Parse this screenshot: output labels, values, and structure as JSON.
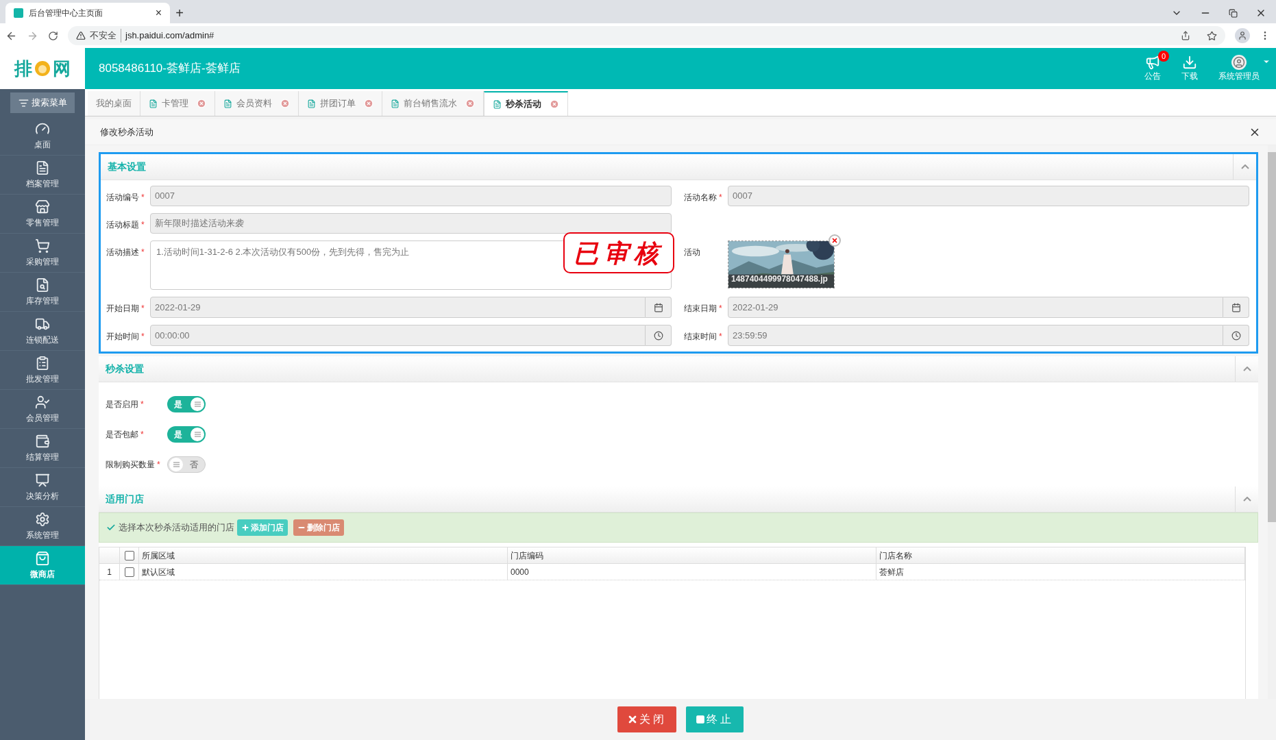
{
  "browser": {
    "tab_title": "后台管理中心主页面",
    "tab_close": "×",
    "new_tab": "+",
    "security": "不安全",
    "url": "jsh.paidui.com/admin#"
  },
  "header": {
    "logo_left": "排",
    "logo_right": "网",
    "title": "8058486110-荟鲜店-荟鲜店",
    "actions": [
      {
        "kind": "notice",
        "label": "公告",
        "badge": "0"
      },
      {
        "kind": "download",
        "label": "下载"
      },
      {
        "kind": "user",
        "label": "系统管理员"
      }
    ]
  },
  "sidebar": {
    "search": "搜索菜单",
    "items": [
      {
        "label": "桌面",
        "selected": false
      },
      {
        "label": "档案管理",
        "selected": false
      },
      {
        "label": "零售管理",
        "selected": false
      },
      {
        "label": "采购管理",
        "selected": false
      },
      {
        "label": "库存管理",
        "selected": false
      },
      {
        "label": "连锁配送",
        "selected": false
      },
      {
        "label": "批发管理",
        "selected": false
      },
      {
        "label": "会员管理",
        "selected": false
      },
      {
        "label": "结算管理",
        "selected": false
      },
      {
        "label": "决策分析",
        "selected": false
      },
      {
        "label": "系统管理",
        "selected": false
      },
      {
        "label": "微商店",
        "selected": true
      }
    ]
  },
  "tabs": [
    {
      "label": "我的桌面",
      "closable": false,
      "selected": false
    },
    {
      "label": "卡管理",
      "closable": true,
      "selected": false
    },
    {
      "label": "会员资料",
      "closable": true,
      "selected": false
    },
    {
      "label": "拼团订单",
      "closable": true,
      "selected": false
    },
    {
      "label": "前台销售流水",
      "closable": true,
      "selected": false
    },
    {
      "label": "秒杀活动",
      "closable": true,
      "selected": true
    }
  ],
  "modal": {
    "title": "修改秒杀活动",
    "stamp": "已审核",
    "basic": {
      "title": "基本设置",
      "expanded": true,
      "rows": [
        [
          {
            "kind": "text",
            "label": "活动编号",
            "required_mark": "*",
            "value": "0007"
          },
          {
            "kind": "text",
            "label": "活动名称",
            "required_mark": "*",
            "value": "0007"
          }
        ],
        [
          {
            "kind": "text",
            "label": "活动标题",
            "required_mark": "*",
            "value": "新年限时描述活动来袭"
          }
        ],
        [
          {
            "kind": "textarea",
            "label": "活动描述",
            "required_mark": "*",
            "value": "1.活动时间1-31-2-6 2.本次活动仅有500份，先到先得，售完为止"
          },
          {
            "label": "活动",
            "file_name": "1487404499978047488.jp"
          }
        ],
        [
          {
            "kind": "date",
            "label": "开始日期",
            "required_mark": "*",
            "value": "2022-01-29"
          },
          {
            "kind": "date",
            "label": "结束日期",
            "required_mark": "*",
            "value": "2022-01-29"
          }
        ],
        [
          {
            "kind": "time",
            "label": "开始时间",
            "required_mark": "*",
            "value": "00:00:00"
          },
          {
            "kind": "time",
            "label": "结束时间",
            "required_mark": "*",
            "value": "23:59:59"
          }
        ]
      ]
    },
    "flash": {
      "title": "秒杀设置",
      "expanded": true,
      "toggles": [
        {
          "label": "是否启用",
          "required_mark": "*",
          "on": true,
          "text": "是"
        },
        {
          "label": "是否包邮",
          "required_mark": "*",
          "on": true,
          "text": "是"
        },
        {
          "label": "限制购买数量",
          "required_mark": "*",
          "on": false,
          "text": "否"
        }
      ]
    },
    "stores": {
      "title": "适用门店",
      "expanded": true,
      "hint": "选择本次秒杀活动适用的门店",
      "add": "添加门店",
      "remove": "删除门店",
      "columns": [
        "所属区域",
        "门店编码",
        "门店名称"
      ],
      "header_checked": false,
      "rows": [
        {
          "index": "1",
          "checked": false,
          "cells": [
            "默认区域",
            "0000",
            "荟鲜店"
          ]
        }
      ]
    },
    "buttons": [
      {
        "kind": "close",
        "label": "关闭"
      },
      {
        "kind": "stop",
        "label": "终止"
      }
    ]
  }
}
